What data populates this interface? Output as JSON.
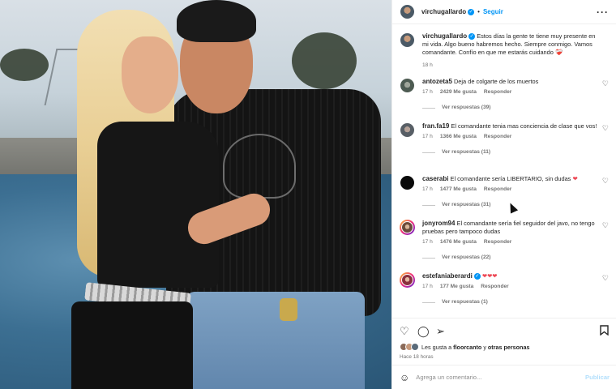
{
  "post_header": {
    "username": "virchugallardo",
    "follow_label": "Seguir",
    "dot": "•",
    "more_icon": "more-horizontal-icon"
  },
  "caption": {
    "username": "virchugallardo",
    "text": "Estos días la gente te tiene muy presente en mi vida. Algo bueno habremos hecho. Siempre conmigo. Vamos comandante. Confío en que me estarás cuidando",
    "emoji": "❤️‍🩹",
    "time": "18 h"
  },
  "comments": [
    {
      "username": "antozeta5",
      "text": "Deja de colgarte de los muertos",
      "time": "17 h",
      "likes": "2429 Me gusta",
      "reply_label": "Responder",
      "view_replies": "Ver respuestas (39)"
    },
    {
      "username": "fran.fa19",
      "text": "El comandante tenia mas conciencia de clase que vos!",
      "time": "17 h",
      "likes": "1366 Me gusta",
      "reply_label": "Responder",
      "view_replies": "Ver respuestas (11)"
    },
    {
      "username": "caserabi",
      "text": "El comandante sería LIBERTARIO, sin dudas",
      "emoji": "❤",
      "time": "17 h",
      "likes": "1477 Me gusta",
      "reply_label": "Responder",
      "view_replies": "Ver respuestas (31)"
    },
    {
      "username": "jonyrom94",
      "text": "El comandante sería fiel seguidor del javo, no tengo pruebas pero tampoco dudas",
      "time": "17 h",
      "likes": "1476 Me gusta",
      "reply_label": "Responder",
      "view_replies": "Ver respuestas (22)"
    },
    {
      "username": "estefaniaberardi",
      "text": "",
      "emoji": "❤❤❤",
      "time": "17 h",
      "likes": "177 Me gusta",
      "reply_label": "Responder",
      "view_replies": "Ver respuestas (1)"
    }
  ],
  "actions": {
    "like_icon": "heart-icon",
    "comment_icon": "comment-icon",
    "share_icon": "send-icon",
    "save_icon": "bookmark-icon",
    "likes_prefix": "Les gusta a",
    "likes_user": "floorcanto",
    "likes_joiner": "y",
    "likes_others": "otras personas",
    "time_ago": "Hace 18 horas"
  },
  "composer": {
    "placeholder": "Agrega un comentario...",
    "publish_label": "Publicar",
    "emoji_icon": "smile-icon"
  },
  "colors": {
    "accent": "#0095f6",
    "heart_red": "#ed4956",
    "muted": "#737373"
  }
}
